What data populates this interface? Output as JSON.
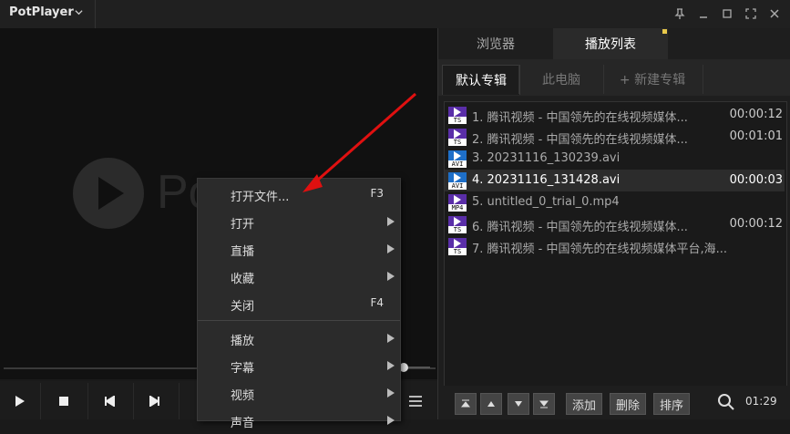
{
  "titlebar": {
    "app_name": "PotPlayer"
  },
  "video": {
    "logo_text": "Po"
  },
  "menu": {
    "items": [
      {
        "label": "打开文件...",
        "shortcut": "F3"
      },
      {
        "label": "打开",
        "shortcut": ""
      },
      {
        "label": "直播",
        "shortcut": ""
      },
      {
        "label": "收藏",
        "shortcut": ""
      },
      {
        "label": "关闭",
        "shortcut": "F4"
      },
      {
        "label": "播放",
        "shortcut": ""
      },
      {
        "label": "字幕",
        "shortcut": ""
      },
      {
        "label": "视频",
        "shortcut": ""
      },
      {
        "label": "声音",
        "shortcut": ""
      }
    ]
  },
  "panel": {
    "tabs": {
      "browser": "浏览器",
      "playlist": "播放列表"
    },
    "albums": {
      "default": "默认专辑",
      "pc": "此电脑",
      "new": "+ 新建专辑"
    },
    "playlist": [
      {
        "icon": "TS",
        "title": "1. 腾讯视频 - 中国领先的在线视频媒体...",
        "duration": "00:00:12"
      },
      {
        "icon": "TS",
        "title": "2. 腾讯视频 - 中国领先的在线视频媒体...",
        "duration": "00:01:01"
      },
      {
        "icon": "AVI",
        "title": "3. 20231116_130239.avi",
        "duration": ""
      },
      {
        "icon": "AVI",
        "title": "4. 20231116_131428.avi",
        "duration": "00:00:03"
      },
      {
        "icon": "MP4",
        "title": "5. untitled_0_trial_0.mp4",
        "duration": ""
      },
      {
        "icon": "TS",
        "title": "6. 腾讯视频 - 中国领先的在线视频媒体...",
        "duration": "00:00:12"
      },
      {
        "icon": "TS",
        "title": "7. 腾讯视频 - 中国领先的在线视频媒体平台,海...",
        "duration": ""
      }
    ],
    "buttons": {
      "add": "添加",
      "delete": "删除",
      "sort": "排序"
    },
    "time": "01:29"
  },
  "colors": {
    "accent": "#5a2ea8",
    "avi": "#1e6fc8",
    "arrow": "#e01010"
  }
}
